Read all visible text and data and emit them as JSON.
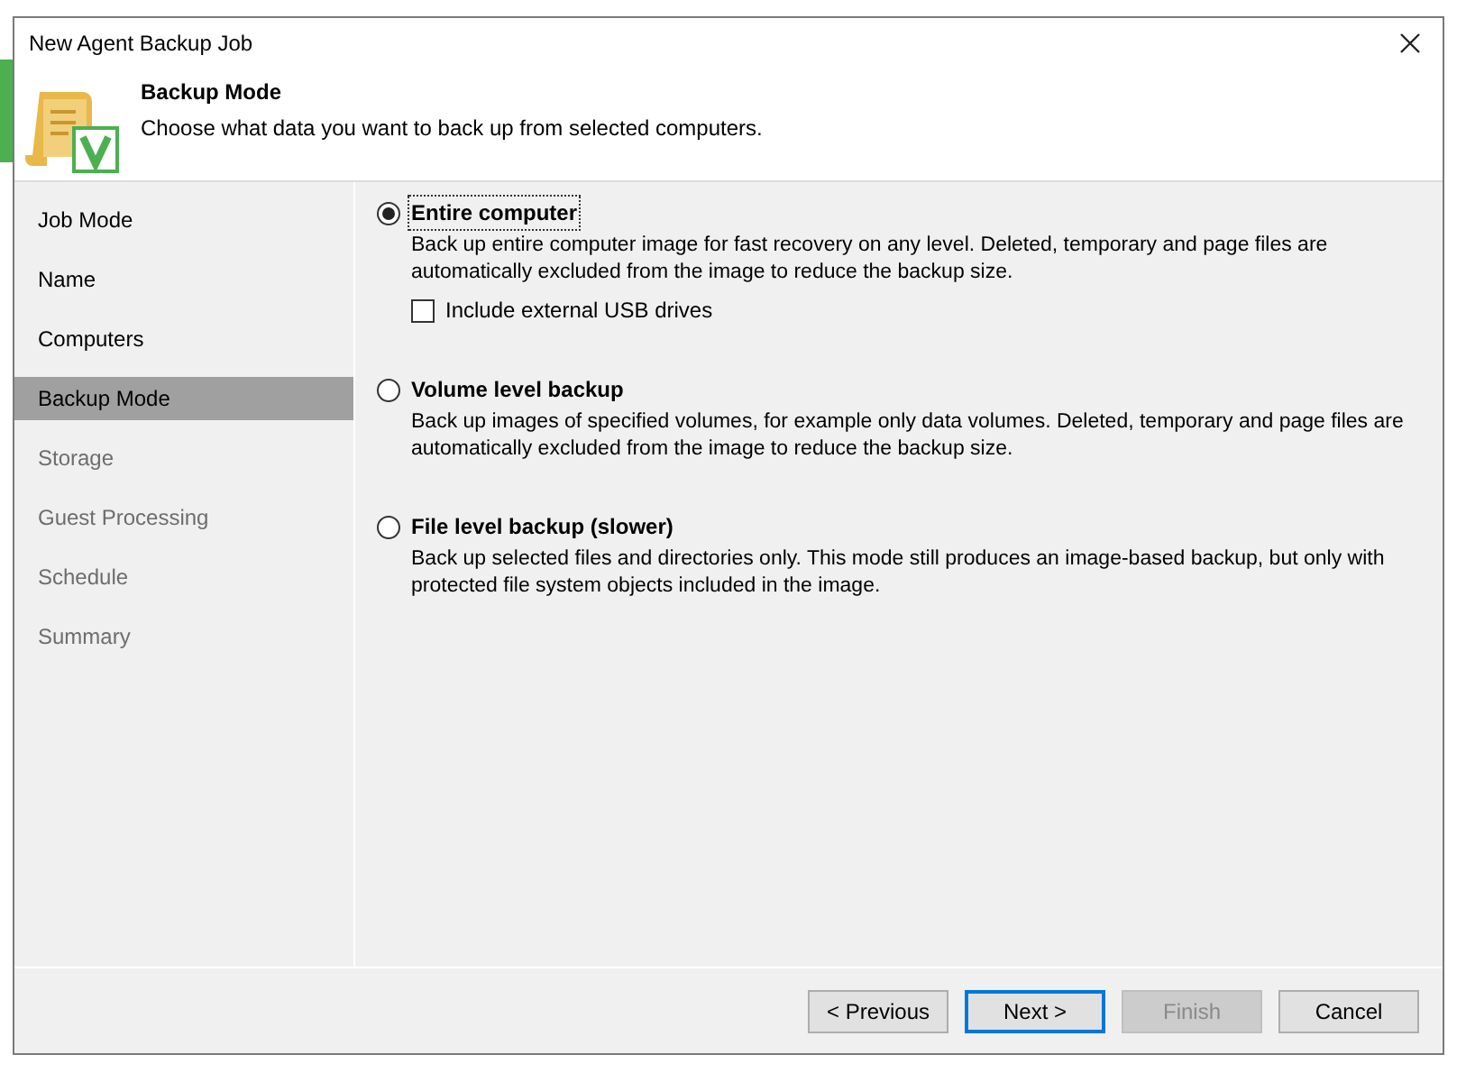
{
  "window": {
    "title": "New Agent Backup Job"
  },
  "header": {
    "title": "Backup Mode",
    "subtitle": "Choose what data you want to back up from selected computers."
  },
  "steps": [
    {
      "label": "Job Mode",
      "selected": false,
      "disabled": false
    },
    {
      "label": "Name",
      "selected": false,
      "disabled": false
    },
    {
      "label": "Computers",
      "selected": false,
      "disabled": false
    },
    {
      "label": "Backup Mode",
      "selected": true,
      "disabled": false
    },
    {
      "label": "Storage",
      "selected": false,
      "disabled": true
    },
    {
      "label": "Guest Processing",
      "selected": false,
      "disabled": true
    },
    {
      "label": "Schedule",
      "selected": false,
      "disabled": true
    },
    {
      "label": "Summary",
      "selected": false,
      "disabled": true
    }
  ],
  "options": [
    {
      "label": "Entire computer",
      "selected": true,
      "description": "Back up entire computer image for fast recovery on any level. Deleted, temporary and page files are automatically excluded from the image to reduce the backup size.",
      "checkbox": {
        "label": "Include external USB drives",
        "checked": false
      }
    },
    {
      "label": "Volume level backup",
      "selected": false,
      "description": "Back up images of specified volumes, for example only data volumes. Deleted, temporary and page files are automatically excluded from the image to reduce the backup size."
    },
    {
      "label": "File level backup (slower)",
      "selected": false,
      "description": "Back up selected files and directories only. This mode still produces an image-based backup, but only with protected file system objects included in the image."
    }
  ],
  "buttons": [
    {
      "label": "< Previous",
      "disabled": false,
      "default": false
    },
    {
      "label": "Next >",
      "disabled": false,
      "default": true
    },
    {
      "label": "Finish",
      "disabled": true,
      "default": false
    },
    {
      "label": "Cancel",
      "disabled": false,
      "default": false
    }
  ]
}
